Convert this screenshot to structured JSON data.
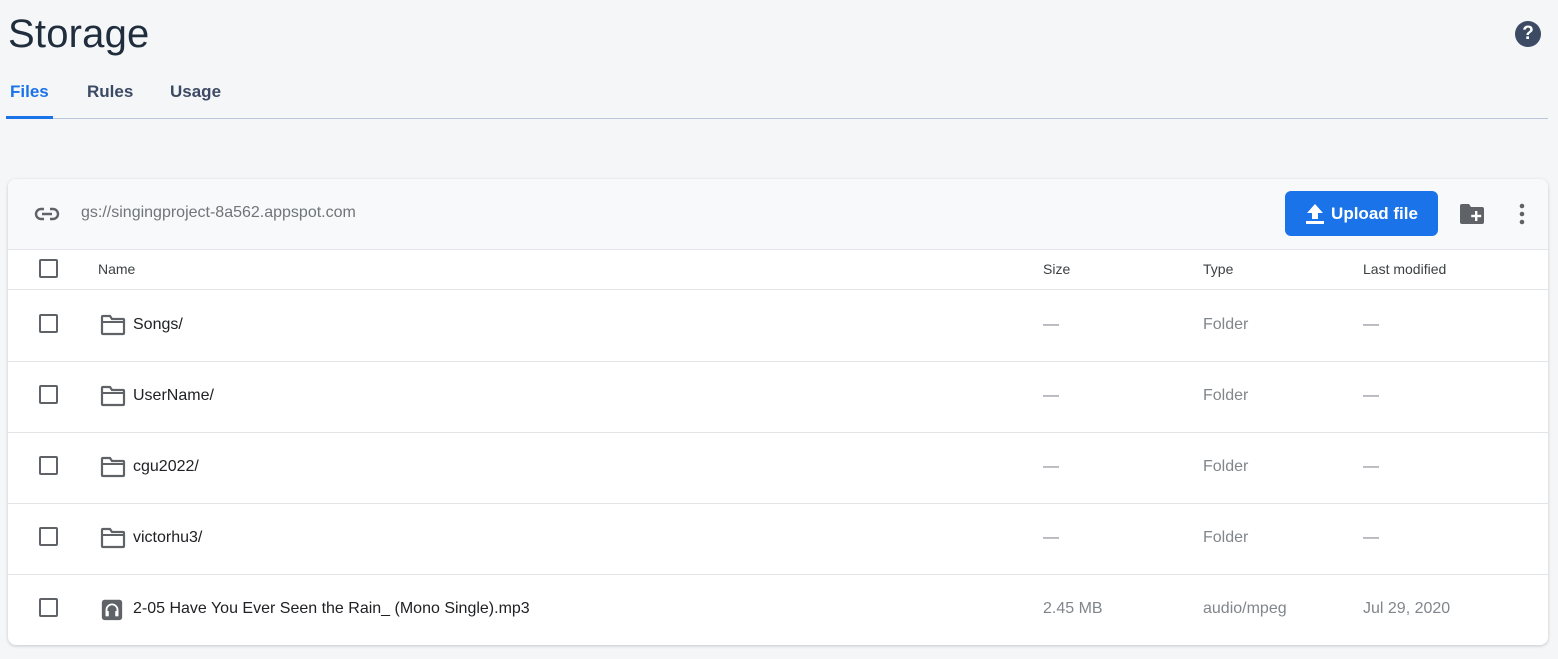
{
  "page": {
    "title": "Storage"
  },
  "help": {
    "glyph": "?"
  },
  "tabs": [
    {
      "label": "Files",
      "active": true
    },
    {
      "label": "Rules",
      "active": false
    },
    {
      "label": "Usage",
      "active": false
    }
  ],
  "toolbar": {
    "bucket_url": "gs://singingproject-8a562.appspot.com",
    "upload_label": "Upload file"
  },
  "table": {
    "columns": {
      "name": "Name",
      "size": "Size",
      "type": "Type",
      "modified": "Last modified"
    },
    "rows": [
      {
        "icon": "folder-icon",
        "name": "Songs/",
        "size": "—",
        "type": "Folder",
        "modified": "—"
      },
      {
        "icon": "folder-icon",
        "name": "UserName/",
        "size": "—",
        "type": "Folder",
        "modified": "—"
      },
      {
        "icon": "folder-icon",
        "name": "cgu2022/",
        "size": "—",
        "type": "Folder",
        "modified": "—"
      },
      {
        "icon": "folder-icon",
        "name": "victorhu3/",
        "size": "—",
        "type": "Folder",
        "modified": "—"
      },
      {
        "icon": "audio-file-icon",
        "name": "2-05 Have You Ever Seen the Rain_ (Mono Single).mp3",
        "size": "2.45 MB",
        "type": "audio/mpeg",
        "modified": "Jul 29, 2020"
      }
    ]
  },
  "colors": {
    "accent": "#1a73e8",
    "title": "#1f2d3d",
    "icon": "#5f6368"
  }
}
